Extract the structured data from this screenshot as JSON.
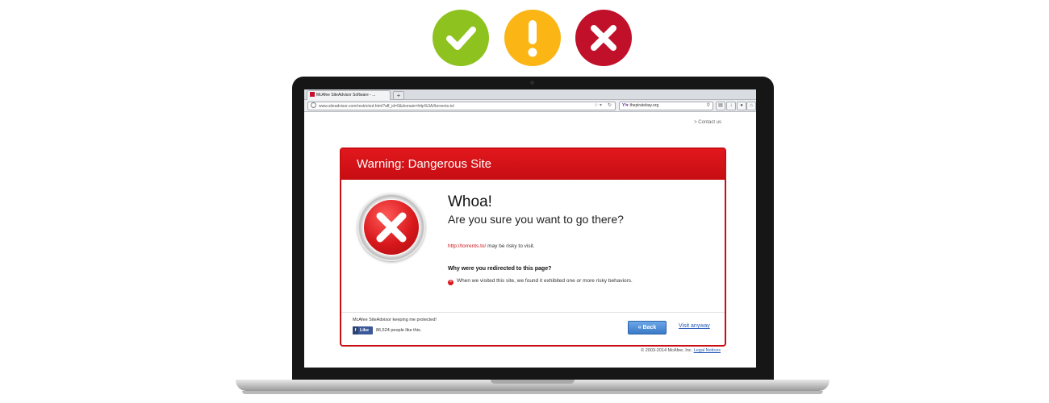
{
  "status_icons": [
    {
      "name": "check-icon",
      "color": "#8dc21f"
    },
    {
      "name": "exclamation-icon",
      "color": "#fbb514"
    },
    {
      "name": "x-icon",
      "color": "#c0102a"
    }
  ],
  "browser": {
    "tab_title": "McAfee SiteAdvisor Software - ...",
    "new_tab": "+",
    "url": "www.siteadvisor.com/restricted.html?aff_id=0&domain=http%3A//torrents.to/",
    "search_value": "thepiratebay.org"
  },
  "page": {
    "contact_link": "> Contact us",
    "panel_title": "Warning: Dangerous Site",
    "headline": "Whoa!",
    "subheadline": "Are you sure you want to go there?",
    "risky_url": "http://torrents.to/",
    "risky_text": " may be risky to visit.",
    "why_heading": "Why were you redirected to this page?",
    "reason_text": "When we visited this site, we found it exhibited one or more risky behaviors.",
    "protected_text": "McAfee SiteAdvisor keeping me protected!",
    "fb_like_label": "Like",
    "fb_count_text": "86,524 people like this.",
    "back_button": "Back",
    "visit_anyway": "Visit anyway",
    "copyright_text": "© 2003-2014 McAfee, Inc. ",
    "legal_notices": "Legal Notices"
  },
  "colors": {
    "warning_red": "#c80f14",
    "link_blue": "#2458b5"
  }
}
